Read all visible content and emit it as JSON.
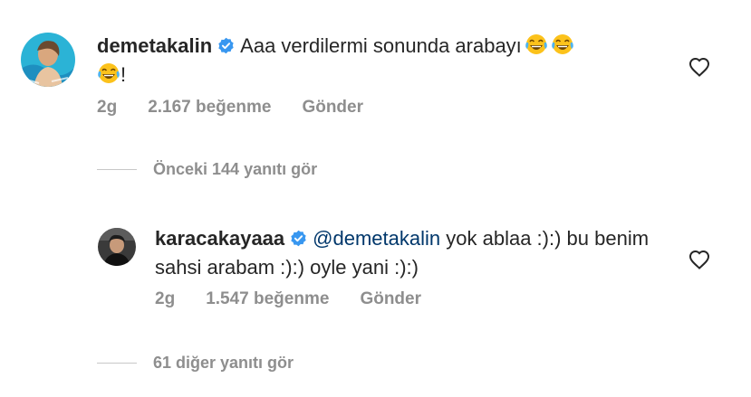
{
  "comment": {
    "username": "demetakalin",
    "text": "Aaa verdilermi sonunda arabayı",
    "text_tail": "!",
    "emoji_icon": "face-with-tears-of-joy-icon",
    "time": "2g",
    "likes": "2.167 beğenme",
    "reply_label": "Gönder"
  },
  "view_previous_replies": "Önceki 144 yanıtı gör",
  "reply": {
    "username": "karacakayaaa",
    "mention": "@demetakalin",
    "text": "yok ablaa :):) bu benim sahsi arabam :):) oyle yani :):)",
    "time": "2g",
    "likes": "1.547 beğenme",
    "reply_label": "Gönder"
  },
  "view_more_replies": "61 diğer yanıtı gör",
  "colors": {
    "verified_blue": "#3897f0",
    "mention_blue": "#00376b",
    "meta_gray": "#8e8e8e",
    "text_dark": "#262626"
  }
}
